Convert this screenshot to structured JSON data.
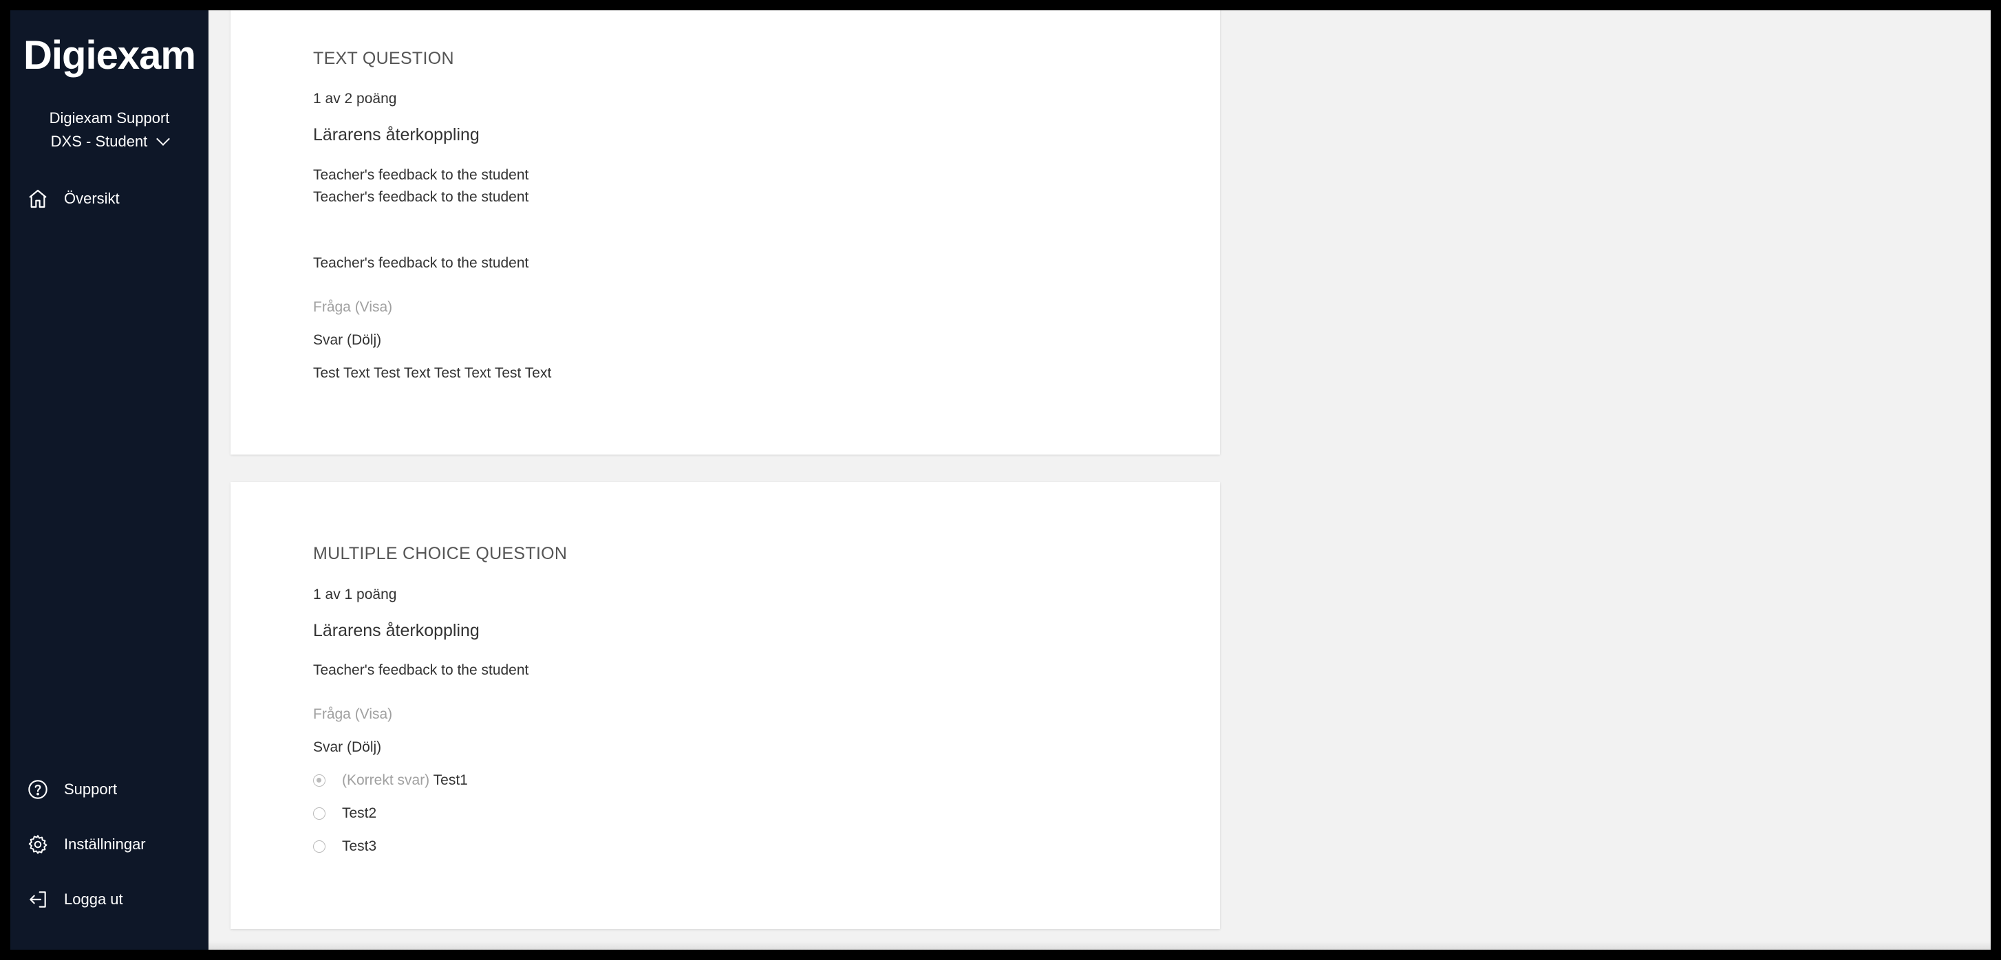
{
  "sidebar": {
    "logo": "Digiexam",
    "account_name": "Digiexam Support",
    "account_role": "DXS - Student",
    "nav_overview": "Översikt",
    "nav_support": "Support",
    "nav_settings": "Inställningar",
    "nav_logout": "Logga ut"
  },
  "questions": [
    {
      "type": "TEXT QUESTION",
      "points": "1 av 2 poäng",
      "feedback_heading": "Lärarens återkoppling",
      "feedback_line1": "Teacher's feedback to the student",
      "feedback_line2": "Teacher's feedback to the student",
      "feedback_line3": "Teacher's feedback to the student",
      "question_toggle": "Fråga (Visa)",
      "answer_toggle": "Svar (Dölj)",
      "answer_text": "Test Text Test Text Test Text Test Text"
    },
    {
      "type": "MULTIPLE CHOICE QUESTION",
      "points": "1 av 1 poäng",
      "feedback_heading": "Lärarens återkoppling",
      "feedback_line1": "Teacher's feedback to the student",
      "question_toggle": "Fråga (Visa)",
      "answer_toggle": "Svar (Dölj)",
      "correct_label": "(Korrekt svar)",
      "options": [
        {
          "label": "Test1",
          "selected": true
        },
        {
          "label": "Test2",
          "selected": false
        },
        {
          "label": "Test3",
          "selected": false
        }
      ]
    }
  ],
  "icons": {
    "overview": "home-icon",
    "support": "help-circle-icon",
    "settings": "gear-icon",
    "logout": "logout-icon"
  },
  "colors": {
    "sidebar_bg": "#0e1728",
    "page_bg": "#f2f2f2",
    "card_bg": "#ffffff"
  }
}
